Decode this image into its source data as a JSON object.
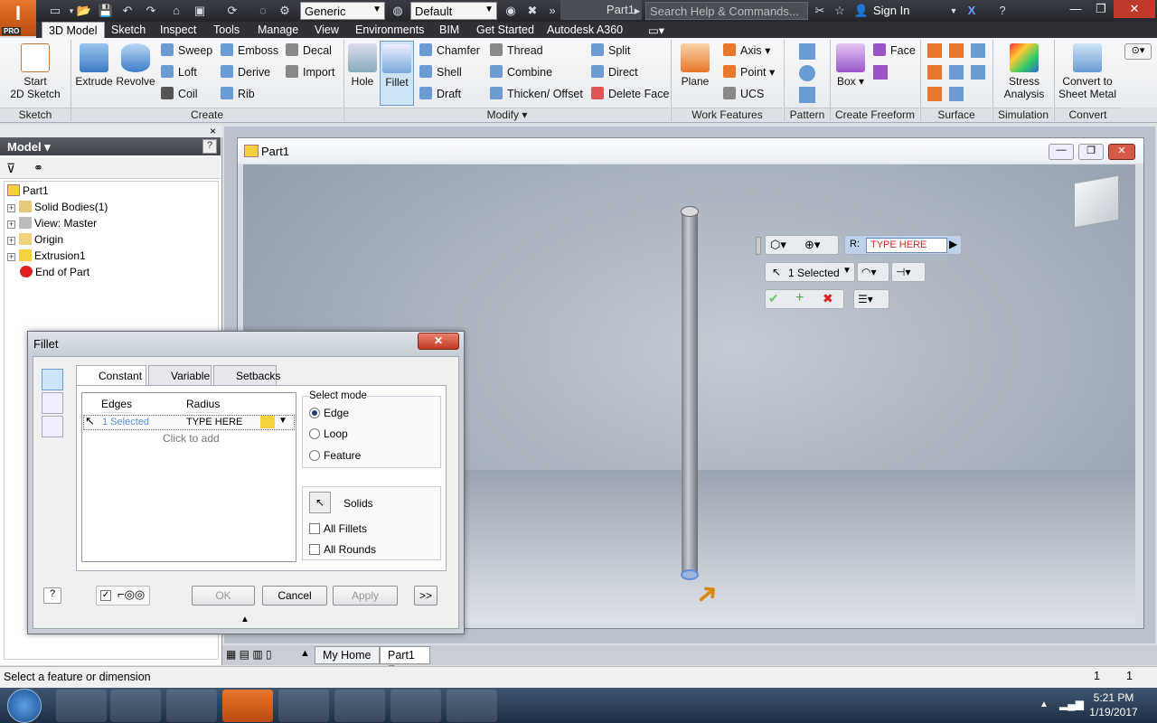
{
  "titlebar": {
    "app_badge": "PRO",
    "material": "Generic",
    "appearance": "Default",
    "document_tab": "Part1",
    "search_placeholder": "Search Help & Commands...",
    "sign_in": "Sign In"
  },
  "ribbon_tabs": [
    "3D Model",
    "Sketch",
    "Inspect",
    "Tools",
    "Manage",
    "View",
    "Environments",
    "BIM",
    "Get Started",
    "Autodesk A360"
  ],
  "ribbon": {
    "sketch": {
      "start_sketch": "Start\n2D Sketch",
      "panel": "Sketch"
    },
    "create": {
      "extrude": "Extrude",
      "revolve": "Revolve",
      "sweep": "Sweep",
      "loft": "Loft",
      "coil": "Coil",
      "emboss": "Emboss",
      "derive": "Derive",
      "rib": "Rib",
      "decal": "Decal",
      "import": "Import",
      "panel": "Create"
    },
    "modify": {
      "hole": "Hole",
      "fillet": "Fillet",
      "chamfer": "Chamfer",
      "shell": "Shell",
      "draft": "Draft",
      "thread": "Thread",
      "combine": "Combine",
      "thicken": "Thicken/ Offset",
      "split": "Split",
      "direct": "Direct",
      "delete_face": "Delete Face",
      "panel": "Modify"
    },
    "work_features": {
      "plane": "Plane",
      "axis": "Axis",
      "point": "Point",
      "ucs": "UCS",
      "panel": "Work Features"
    },
    "pattern": {
      "panel": "Pattern"
    },
    "freeform": {
      "box": "Box",
      "face": "Face",
      "panel": "Create Freeform"
    },
    "surface": {
      "panel": "Surface"
    },
    "simulation": {
      "stress": "Stress\nAnalysis",
      "panel": "Simulation"
    },
    "convert": {
      "sheet_metal": "Convert to\nSheet Metal",
      "panel": "Convert"
    }
  },
  "browser": {
    "title": "Model",
    "items": [
      {
        "label": "Part1",
        "expandable": false
      },
      {
        "label": "Solid Bodies(1)",
        "expandable": true
      },
      {
        "label": "View: Master",
        "expandable": true
      },
      {
        "label": "Origin",
        "expandable": true
      },
      {
        "label": "Extrusion1",
        "expandable": true
      },
      {
        "label": "End of Part",
        "expandable": false
      }
    ]
  },
  "graphics": {
    "window_title": "Part1",
    "radius_prefix": "R:",
    "radius_value": "TYPE HERE",
    "selection": "1 Selected"
  },
  "dialog": {
    "title": "Fillet",
    "tabs": [
      "Constant",
      "Variable",
      "Setbacks"
    ],
    "columns": [
      "Edges",
      "Radius"
    ],
    "row": {
      "edges": "1 Selected",
      "radius": "TYPE HERE"
    },
    "click_to_add": "Click to add",
    "select_mode_label": "Select mode",
    "modes": [
      "Edge",
      "Loop",
      "Feature"
    ],
    "selected_mode": "Edge",
    "solids": "Solids",
    "all_fillets": "All Fillets",
    "all_rounds": "All Rounds",
    "ok": "OK",
    "cancel": "Cancel",
    "apply": "Apply",
    "more": ">>"
  },
  "doc_tabs": [
    "My Home",
    "Part1"
  ],
  "status": {
    "message": "Select a feature or dimension",
    "count1": "1",
    "count2": "1"
  },
  "taskbar": {
    "time": "5:21 PM",
    "date": "1/19/2017"
  },
  "colors": {
    "accent": "#e8762b",
    "selection_blue": "#5b8de0",
    "cancel_red": "#d22"
  }
}
